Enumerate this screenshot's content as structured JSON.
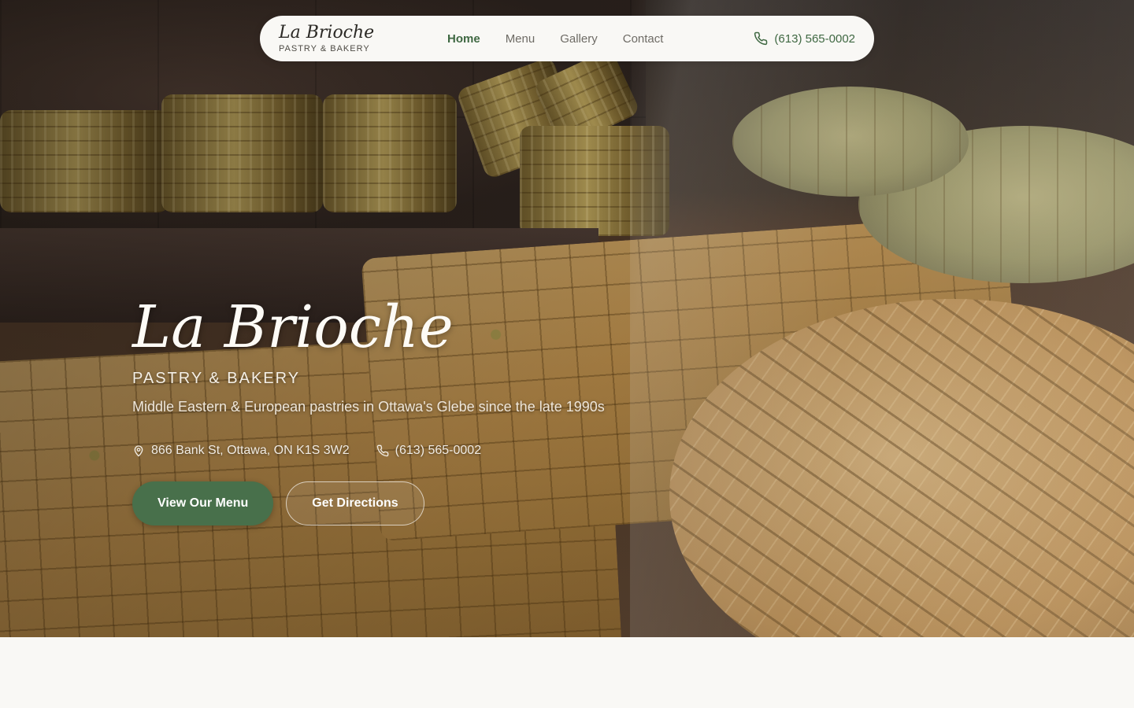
{
  "nav": {
    "brand_name": "La Brioche",
    "brand_sub": "PASTRY & BAKERY",
    "links": [
      {
        "label": "Home",
        "active": true
      },
      {
        "label": "Menu",
        "active": false
      },
      {
        "label": "Gallery",
        "active": false
      },
      {
        "label": "Contact",
        "active": false
      }
    ],
    "phone": "(613) 565-0002",
    "phone_icon": "phone-icon"
  },
  "hero": {
    "title": "La Brioche",
    "subtitle": "PASTRY & BAKERY",
    "tagline": "Middle Eastern & European pastries in Ottawa's Glebe since the late 1990s",
    "address": "866 Bank St, Ottawa, ON K1S 3W2",
    "address_icon": "map-pin-icon",
    "phone": "(613) 565-0002",
    "phone_icon": "phone-icon",
    "primary_button": "View Our Menu",
    "secondary_button": "Get Directions"
  },
  "colors": {
    "accent_green": "#48704b",
    "nav_active": "#3f6842",
    "page_background": "#f9f8f5"
  }
}
